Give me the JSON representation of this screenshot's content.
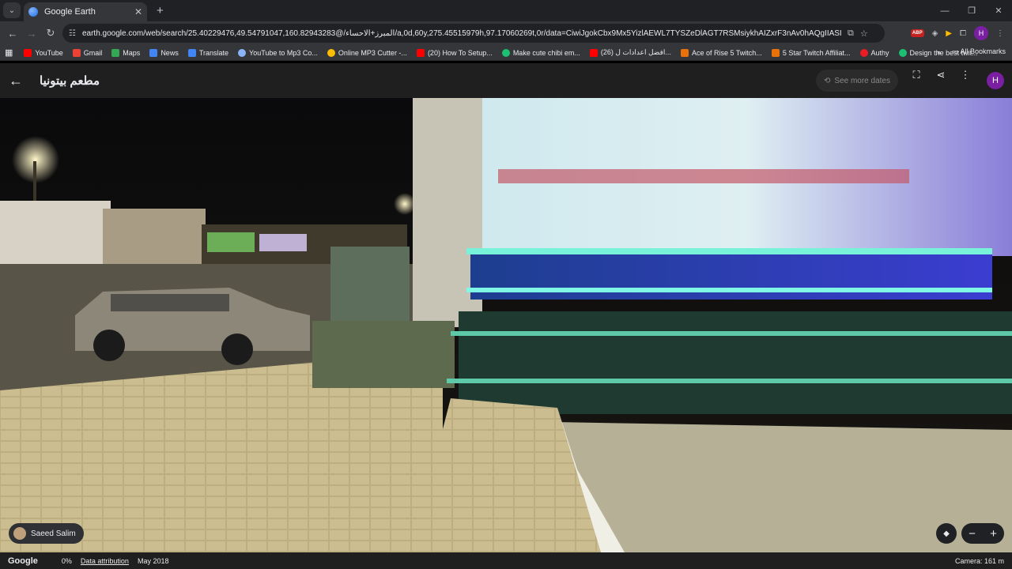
{
  "browser": {
    "tab_title": "Google Earth",
    "url": "earth.google.com/web/search/25.40229476,49.54791047,160.82943283@/المبرز+الاحساء/a,0d,60y,275.45515979h,97.17060269t,0r/data=CiwiJgokCbx9Mx5YizlAEWL7TYSZeDlAGT7RSMsiykhAIZxrF3nAv0hAQgIIASIbChdDSUhNMG9nS0..."
  },
  "bookmarks": [
    {
      "label": "YouTube",
      "color": "#ff0000"
    },
    {
      "label": "Gmail",
      "color": "#ea4335"
    },
    {
      "label": "Maps",
      "color": "#34a853"
    },
    {
      "label": "News",
      "color": "#4285f4"
    },
    {
      "label": "Translate",
      "color": "#4285f4"
    },
    {
      "label": "YouTube to Mp3 Co...",
      "color": "#8ab4f8"
    },
    {
      "label": "Online MP3 Cutter -...",
      "color": "#fbbc04"
    },
    {
      "label": "(20) How To Setup...",
      "color": "#ff0000"
    },
    {
      "label": "Make cute chibi em...",
      "color": "#1dbf73"
    },
    {
      "label": "(26) افضل اعدادات ل...",
      "color": "#ff0000"
    },
    {
      "label": "Ace of Rise 5 Twitch...",
      "color": "#e8710a"
    },
    {
      "label": "5 Star Twitch Affiliat...",
      "color": "#e8710a"
    },
    {
      "label": "Authy",
      "color": "#ec1c24"
    },
    {
      "label": "Design the best twit...",
      "color": "#1dbf73"
    }
  ],
  "bookmarks_all": "All Bookmarks",
  "earth": {
    "place_title": "مطعم بيتونيا",
    "see_more_dates": "See more dates",
    "avatar_letter": "H",
    "author": "Saeed Salim",
    "logo": "Google",
    "load_percent": "0%",
    "data_attribution": "Data attribution",
    "capture_date": "May 2018",
    "camera": "Camera: 161 m"
  },
  "profile_letter": "H"
}
